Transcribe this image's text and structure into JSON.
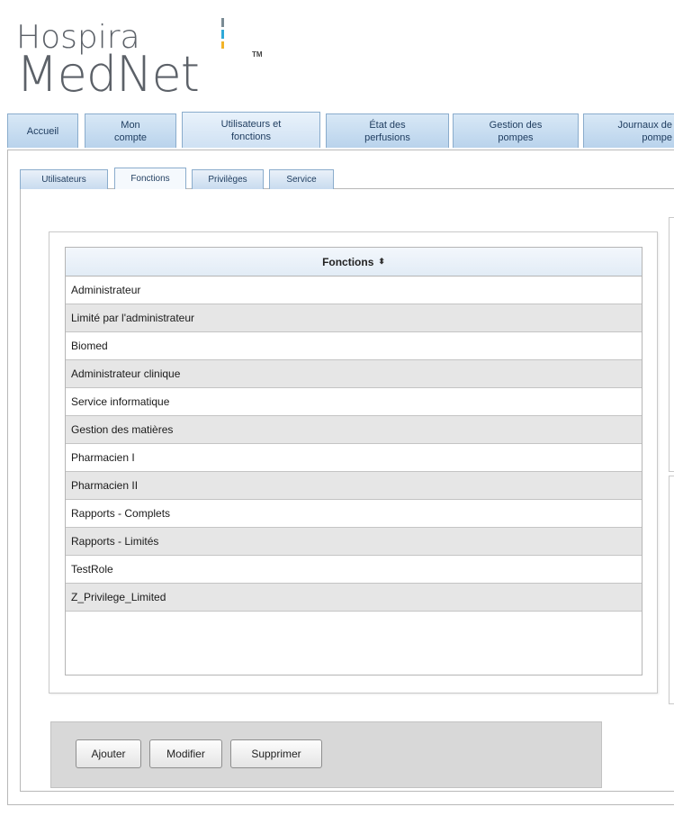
{
  "logo": {
    "line1": "Hospira",
    "line2": "MedNet",
    "tm": "TM"
  },
  "main_tabs": [
    {
      "label": "Accueil",
      "active": false
    },
    {
      "label": "Mon\ncompte",
      "active": false
    },
    {
      "label": "Utilisateurs et\nfonctions",
      "active": true
    },
    {
      "label": "État des\nperfusions",
      "active": false
    },
    {
      "label": "Gestion des\npompes",
      "active": false
    },
    {
      "label": "Journaux de\npompe",
      "active": false
    }
  ],
  "sub_tabs": [
    {
      "label": "Utilisateurs",
      "active": false
    },
    {
      "label": "Fonctions",
      "active": true
    },
    {
      "label": "Privilèges",
      "active": false
    },
    {
      "label": "Service",
      "active": false
    }
  ],
  "grid": {
    "header": "Fonctions",
    "sort_icon": "⬍",
    "rows": [
      "Administrateur",
      "Limité par l'administrateur",
      "Biomed",
      "Administrateur clinique",
      "Service informatique",
      "Gestion des matières",
      "Pharmacien I",
      "Pharmacien II",
      "Rapports - Complets",
      "Rapports - Limités",
      "TestRole",
      "Z_Privilege_Limited"
    ]
  },
  "actions": {
    "add": "Ajouter",
    "edit": "Modifier",
    "delete": "Supprimer"
  },
  "colors": {
    "tab_bg": "#c9ddf1",
    "tab_border": "#8aaccc",
    "row_alt": "#e6e6e6",
    "action_bar": "#d8d8d8"
  }
}
